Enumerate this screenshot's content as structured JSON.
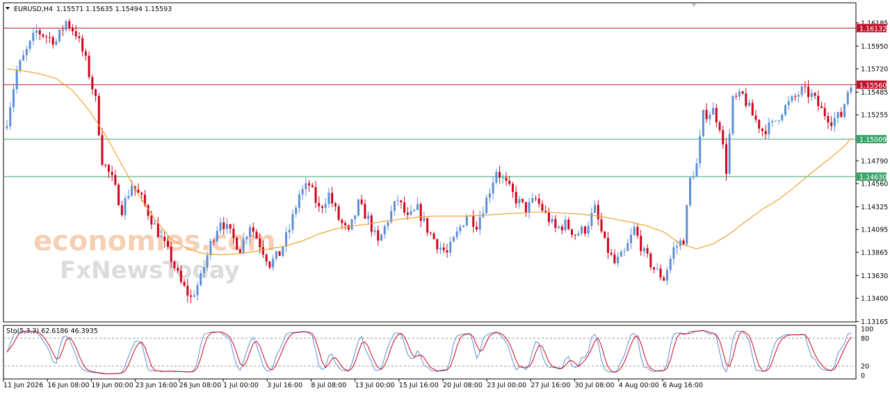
{
  "window": {
    "symbol_header": "EURUSD,H4",
    "ohlc": "1.15571 1.15635 1.15494 1.15593"
  },
  "watermark": {
    "line1": "economies.com",
    "line2": "FxNewsToday"
  },
  "colors": {
    "bull": "#5b8fd6",
    "bear": "#d0021b",
    "ma": "#f0a030",
    "resistance": "#c0142c",
    "support": "#3aa56b",
    "stoch_main": "#5b8fd6",
    "stoch_signal": "#d0021b",
    "watermark": "#f6c7a8"
  },
  "chart_data": [
    {
      "type": "candlestick",
      "title": "EURUSD,H4",
      "price_axis": {
        "ticks": [
          "1.16185",
          "1.15950",
          "1.15720",
          "1.15485",
          "1.15255",
          "1.14790",
          "1.14560",
          "1.14325",
          "1.14095",
          "1.13865",
          "1.13630",
          "1.13400",
          "1.13165"
        ],
        "ylim": [
          1.13165,
          1.1625
        ]
      },
      "time_axis": {
        "labels": [
          "11 Jun 2026",
          "16 Jun 08:00",
          "19 Jun 00:00",
          "23 Jun 16:00",
          "26 Jun 08:00",
          "1 Jul 00:00",
          "3 Jul 16:00",
          "8 Jul 08:00",
          "13 Jul 00:00",
          "15 Jul 16:00",
          "20 Jul 08:00",
          "23 Jul 00:00",
          "27 Jul 16:00",
          "30 Jul 08:00",
          "4 Aug 00:00",
          "6 Aug 16:00"
        ]
      },
      "horizontal_levels": [
        {
          "price": 1.16132,
          "label": "1.16132",
          "kind": "resistance"
        },
        {
          "price": 1.1556,
          "label": "1.15560",
          "kind": "resistance"
        },
        {
          "price": 1.15009,
          "label": "1.15009",
          "kind": "support"
        },
        {
          "price": 1.1463,
          "label": "1.14630",
          "kind": "support"
        }
      ],
      "close_path": [
        [
          0,
          1.152
        ],
        [
          3,
          1.157
        ],
        [
          6,
          1.159
        ],
        [
          9,
          1.161
        ],
        [
          12,
          1.1605
        ],
        [
          15,
          1.16
        ],
        [
          18,
          1.162
        ],
        [
          21,
          1.1608
        ],
        [
          24,
          1.158
        ],
        [
          27,
          1.154
        ],
        [
          29,
          1.148
        ],
        [
          32,
          1.146
        ],
        [
          35,
          1.143
        ],
        [
          38,
          1.1455
        ],
        [
          41,
          1.144
        ],
        [
          44,
          1.142
        ],
        [
          47,
          1.14
        ],
        [
          50,
          1.138
        ],
        [
          53,
          1.1355
        ],
        [
          56,
          1.134
        ],
        [
          59,
          1.136
        ],
        [
          62,
          1.1395
        ],
        [
          65,
          1.142
        ],
        [
          68,
          1.1405
        ],
        [
          71,
          1.139
        ],
        [
          74,
          1.1415
        ],
        [
          77,
          1.1395
        ],
        [
          80,
          1.1375
        ],
        [
          83,
          1.1385
        ],
        [
          86,
          1.141
        ],
        [
          89,
          1.1445
        ],
        [
          92,
          1.1455
        ],
        [
          95,
          1.143
        ],
        [
          98,
          1.1445
        ],
        [
          101,
          1.142
        ],
        [
          104,
          1.1405
        ],
        [
          107,
          1.1435
        ],
        [
          110,
          1.142
        ],
        [
          113,
          1.1395
        ],
        [
          116,
          1.142
        ],
        [
          119,
          1.144
        ],
        [
          122,
          1.142
        ],
        [
          125,
          1.143
        ],
        [
          128,
          1.141
        ],
        [
          131,
          1.1395
        ],
        [
          134,
          1.1385
        ],
        [
          137,
          1.1405
        ],
        [
          140,
          1.1425
        ],
        [
          143,
          1.1415
        ],
        [
          146,
          1.144
        ],
        [
          149,
          1.147
        ],
        [
          152,
          1.1455
        ],
        [
          155,
          1.144
        ],
        [
          158,
          1.143
        ],
        [
          161,
          1.144
        ],
        [
          164,
          1.1425
        ],
        [
          167,
          1.141
        ],
        [
          170,
          1.1415
        ],
        [
          173,
          1.1405
        ],
        [
          176,
          1.141
        ],
        [
          179,
          1.143
        ],
        [
          182,
          1.1395
        ],
        [
          185,
          1.1375
        ],
        [
          188,
          1.1385
        ],
        [
          191,
          1.141
        ],
        [
          194,
          1.1385
        ],
        [
          197,
          1.137
        ],
        [
          200,
          1.136
        ],
        [
          203,
          1.139
        ],
        [
          206,
          1.14
        ],
        [
          208,
          1.146
        ],
        [
          210,
          1.1475
        ],
        [
          212,
          1.1525
        ],
        [
          215,
          1.153
        ],
        [
          217,
          1.1515
        ],
        [
          219,
          1.147
        ],
        [
          221,
          1.154
        ],
        [
          224,
          1.1545
        ],
        [
          227,
          1.1525
        ],
        [
          230,
          1.151
        ],
        [
          233,
          1.1515
        ],
        [
          236,
          1.153
        ],
        [
          239,
          1.154
        ],
        [
          242,
          1.155
        ],
        [
          245,
          1.1545
        ],
        [
          248,
          1.153
        ],
        [
          251,
          1.152
        ],
        [
          254,
          1.1525
        ],
        [
          256,
          1.155
        ],
        [
          257,
          1.1559
        ]
      ],
      "moving_average": [
        [
          0,
          1.1572
        ],
        [
          5,
          1.157
        ],
        [
          10,
          1.1567
        ],
        [
          15,
          1.1562
        ],
        [
          20,
          1.155
        ],
        [
          25,
          1.153
        ],
        [
          30,
          1.1505
        ],
        [
          35,
          1.1475
        ],
        [
          40,
          1.1445
        ],
        [
          45,
          1.142
        ],
        [
          50,
          1.14
        ],
        [
          55,
          1.139
        ],
        [
          60,
          1.1385
        ],
        [
          65,
          1.1384
        ],
        [
          70,
          1.1385
        ],
        [
          75,
          1.1387
        ],
        [
          80,
          1.139
        ],
        [
          85,
          1.1393
        ],
        [
          90,
          1.1398
        ],
        [
          95,
          1.1405
        ],
        [
          100,
          1.141
        ],
        [
          105,
          1.1413
        ],
        [
          110,
          1.1415
        ],
        [
          115,
          1.1418
        ],
        [
          120,
          1.142
        ],
        [
          125,
          1.1422
        ],
        [
          130,
          1.1423
        ],
        [
          135,
          1.1423
        ],
        [
          140,
          1.1423
        ],
        [
          145,
          1.1424
        ],
        [
          150,
          1.1425
        ],
        [
          155,
          1.1426
        ],
        [
          160,
          1.1427
        ],
        [
          165,
          1.1427
        ],
        [
          170,
          1.1426
        ],
        [
          175,
          1.1425
        ],
        [
          180,
          1.1423
        ],
        [
          185,
          1.142
        ],
        [
          190,
          1.1417
        ],
        [
          195,
          1.1413
        ],
        [
          200,
          1.1407
        ],
        [
          205,
          1.1395
        ],
        [
          210,
          1.139
        ],
        [
          215,
          1.1395
        ],
        [
          220,
          1.1405
        ],
        [
          225,
          1.1418
        ],
        [
          230,
          1.143
        ],
        [
          235,
          1.144
        ],
        [
          240,
          1.1453
        ],
        [
          245,
          1.1467
        ],
        [
          250,
          1.148
        ],
        [
          255,
          1.1494
        ],
        [
          257,
          1.1502
        ]
      ]
    },
    {
      "type": "line",
      "title": "Sto(5,3,3) 62.6186 46.3935",
      "indicator": "Sto(5,3,3)",
      "values": [
        "62.6186",
        "46.3935"
      ],
      "ylim": [
        0,
        100
      ],
      "ticks": [
        "100",
        "80",
        "20",
        "0"
      ],
      "levels": [
        80,
        20
      ]
    }
  ]
}
